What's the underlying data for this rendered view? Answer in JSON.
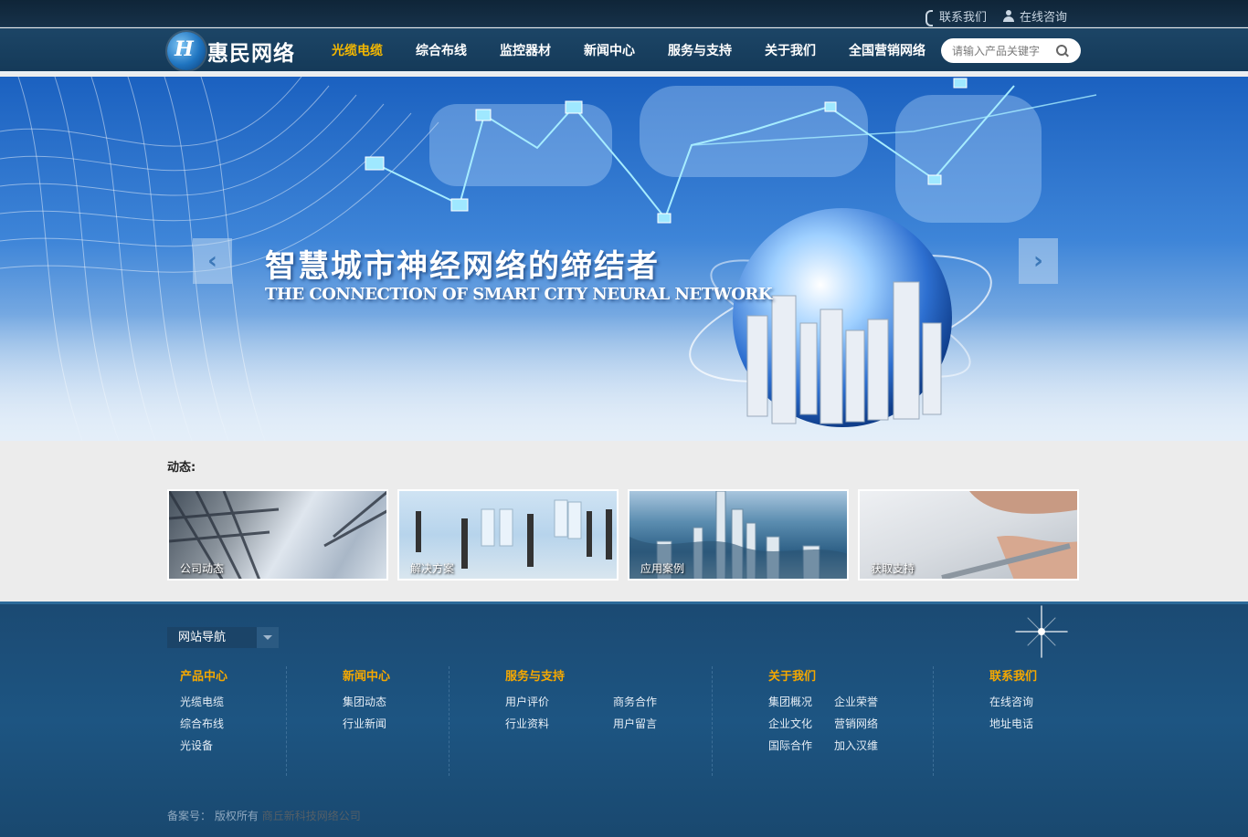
{
  "topbar": {
    "contact": "联系我们",
    "consult": "在线咨询"
  },
  "header": {
    "logo_text": "惠民网络",
    "nav": [
      "光缆电缆",
      "综合布线",
      "监控器材",
      "新闻中心",
      "服务与支持",
      "关于我们",
      "全国营销网络"
    ],
    "active_nav": "光缆电缆",
    "search_placeholder": "请输入产品关键字"
  },
  "banner": {
    "title_cn": "智慧城市神经网络的缔结者",
    "title_en": "THE CONNECTION OF SMART CITY NEURAL NETWORK"
  },
  "news": {
    "label": "动态:",
    "cards": [
      "公司动态",
      "解决方案",
      "应用案例",
      "获取支持"
    ]
  },
  "footer": {
    "site_nav": "网站导航",
    "columns": [
      {
        "title": "产品中心",
        "links": [
          "光缆电缆",
          "综合布线",
          "光设备"
        ]
      },
      {
        "title": "新闻中心",
        "links": [
          "集团动态",
          "行业新闻"
        ]
      },
      {
        "title": "服务与支持",
        "links": [
          "用户评价",
          "商务合作",
          "行业资料",
          "用户留言"
        ]
      },
      {
        "title": "关于我们",
        "links": [
          "集团概况",
          "企业荣誉",
          "企业文化",
          "营销网络",
          "国际合作",
          "加入汉维"
        ]
      },
      {
        "title": "联系我们",
        "links": [
          "在线咨询",
          "地址电话"
        ]
      }
    ],
    "record_label": "备案号：",
    "rights": "版权所有",
    "company": "商丘新科技网络公司"
  },
  "colors": {
    "accent": "#f5a800",
    "nav_active": "#f5b800",
    "header_bg": "#1c4566",
    "footer_bg": "#1d5582"
  },
  "icons": {
    "phone": "phone-icon",
    "user": "user-icon",
    "search": "search-icon",
    "prev": "chevron-left-icon",
    "next": "chevron-right-icon",
    "dropdown": "chevron-down-icon"
  }
}
